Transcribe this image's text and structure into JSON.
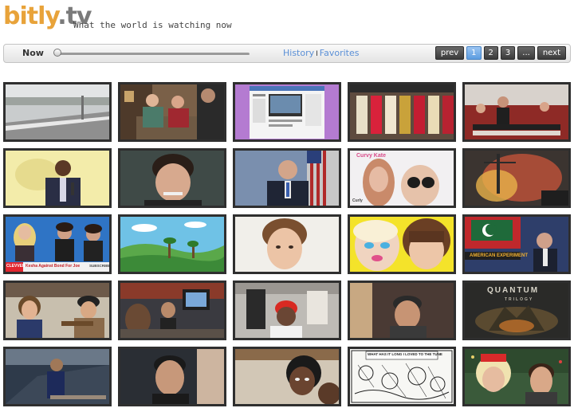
{
  "header": {
    "logo_part1": "bitly",
    "logo_part2": ".tv",
    "tagline": "What the world is watching now"
  },
  "toolbar": {
    "now_label": "Now",
    "history_link": "History",
    "separator": "I",
    "favorites_link": "Favorites",
    "pager": {
      "prev": "prev",
      "pages": [
        "1",
        "2",
        "3"
      ],
      "ellipsis": "...",
      "next": "next",
      "active_page": "1"
    }
  },
  "thumbnails": {
    "t3_caption": "Curvy Kate",
    "t3_corner": "Curly",
    "t10_banner": "Kesha Against Bond For Joe",
    "t10_tag": "SUBSCRIBE",
    "t10_logo": "CLEVVER",
    "t14_caption": "AMERICAN EXPERIMENT",
    "t15_title": "QUANTUM",
    "t15_sub": "TRILOGY",
    "t16_speech": "WHAT HAS IT LONG I LOVED TO THE TUNE"
  },
  "colors": {
    "logo_orange": "#e8a33a",
    "logo_gray": "#7a7a7a",
    "link_blue": "#5a8fd6",
    "active_page": "#5c9ce0"
  }
}
